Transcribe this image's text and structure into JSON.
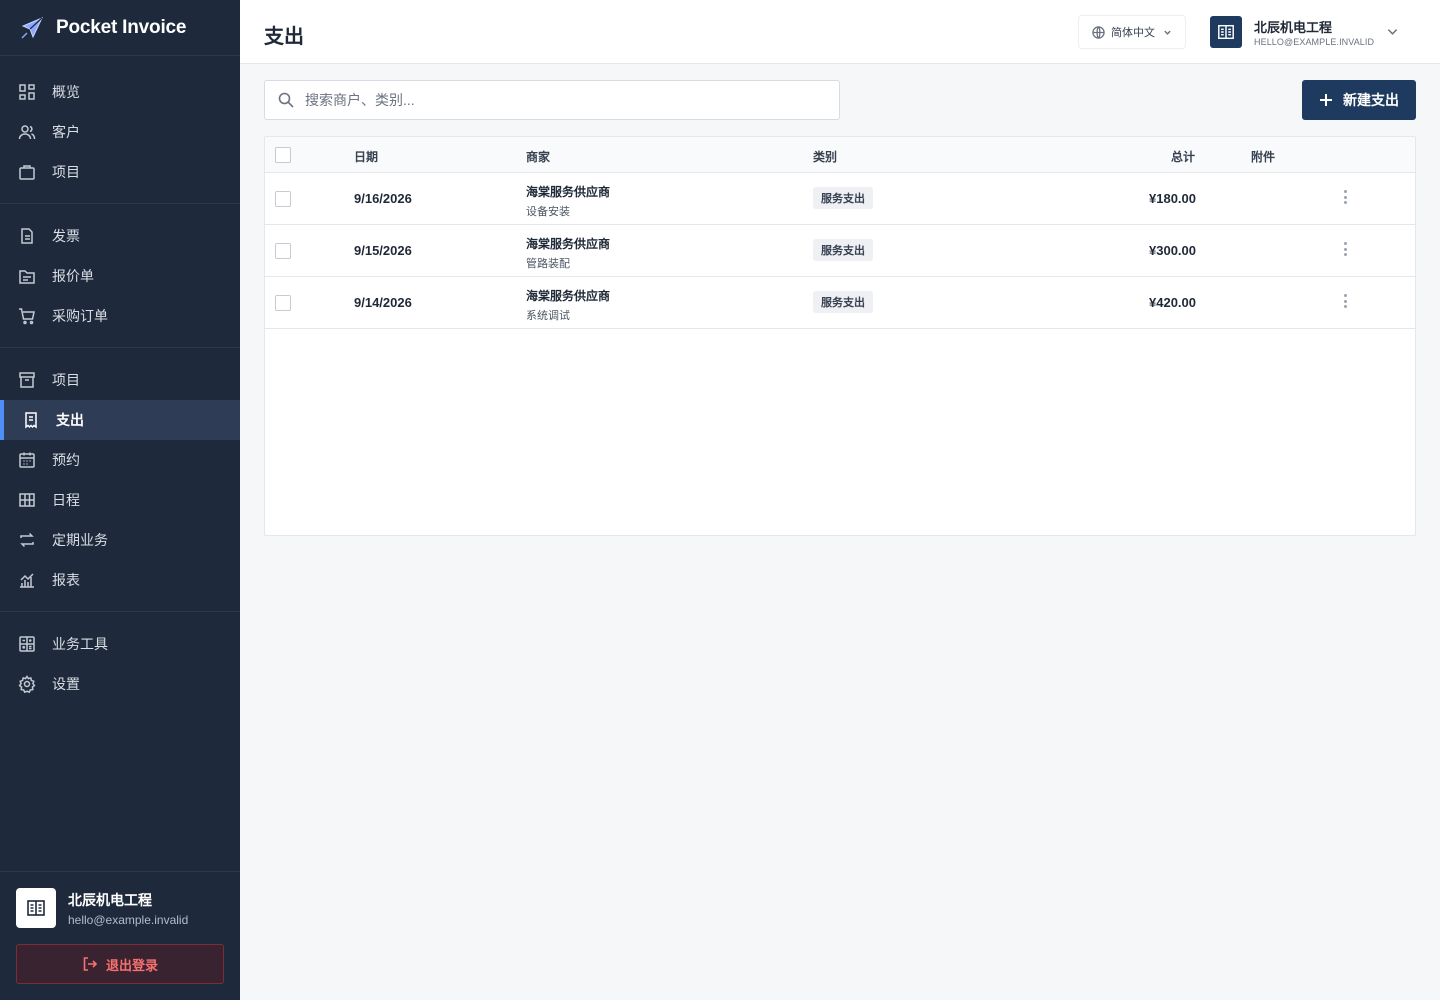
{
  "app": {
    "name": "Pocket Invoice"
  },
  "sidebar": {
    "groups": [
      [
        {
          "label": "概览",
          "icon": "dashboard-icon"
        },
        {
          "label": "客户",
          "icon": "users-icon"
        },
        {
          "label": "项目",
          "icon": "briefcase-icon"
        }
      ],
      [
        {
          "label": "发票",
          "icon": "document-icon"
        },
        {
          "label": "报价单",
          "icon": "folder-icon"
        },
        {
          "label": "采购订单",
          "icon": "cart-icon"
        }
      ],
      [
        {
          "label": "项目",
          "icon": "archive-icon"
        },
        {
          "label": "支出",
          "icon": "receipt-icon",
          "active": true
        },
        {
          "label": "预约",
          "icon": "calendar-icon"
        },
        {
          "label": "日程",
          "icon": "grid-icon"
        },
        {
          "label": "定期业务",
          "icon": "repeat-icon"
        },
        {
          "label": "报表",
          "icon": "chart-icon"
        }
      ],
      [
        {
          "label": "业务工具",
          "icon": "calculator-icon"
        },
        {
          "label": "设置",
          "icon": "gear-icon"
        }
      ]
    ],
    "footer": {
      "company": "北辰机电工程",
      "email": "hello@example.invalid",
      "logout_label": "退出登录"
    }
  },
  "header": {
    "title": "支出",
    "language": "简体中文",
    "account_name": "北辰机电工程",
    "account_email": "HELLO@EXAMPLE.INVALID"
  },
  "toolbar": {
    "search_placeholder": "搜索商户、类别...",
    "search_value": "",
    "new_button_label": "新建支出"
  },
  "table": {
    "columns": {
      "date": "日期",
      "merchant": "商家",
      "category": "类别",
      "total": "总计",
      "attachment": "附件"
    },
    "rows": [
      {
        "date": "9/16/2026",
        "merchant": "海棠服务供应商",
        "description": "设备安装",
        "category": "服务支出",
        "total": "¥180.00",
        "attachment": ""
      },
      {
        "date": "9/15/2026",
        "merchant": "海棠服务供应商",
        "description": "管路装配",
        "category": "服务支出",
        "total": "¥300.00",
        "attachment": ""
      },
      {
        "date": "9/14/2026",
        "merchant": "海棠服务供应商",
        "description": "系统调试",
        "category": "服务支出",
        "total": "¥420.00",
        "attachment": ""
      }
    ]
  },
  "colors": {
    "sidebar_bg": "#1e2a3b",
    "accent": "#1e3a5f",
    "active_indicator": "#4f8df7",
    "danger": "#f87171"
  }
}
